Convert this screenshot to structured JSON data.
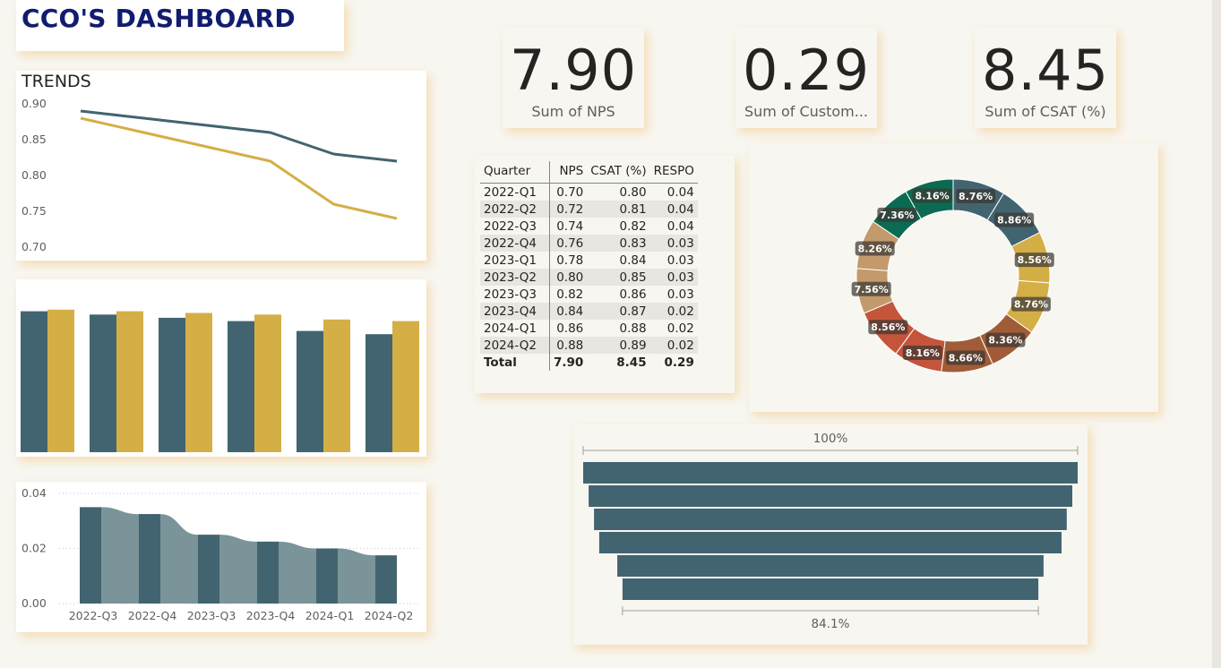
{
  "header": {
    "title": "CCO'S DASHBOARD"
  },
  "kpis": [
    {
      "value": "7.90",
      "label": "Sum of NPS"
    },
    {
      "value": "0.29",
      "label": "Sum of Custom..."
    },
    {
      "value": "8.45",
      "label": "Sum of CSAT (%)"
    }
  ],
  "trends": {
    "title": "TRENDS",
    "y_ticks": [
      "0.90",
      "0.85",
      "0.80",
      "0.75",
      "0.70"
    ]
  },
  "table": {
    "headers": [
      "Quarter",
      "NPS",
      "CSAT (%)",
      "RESPO"
    ],
    "rows": [
      [
        "2022-Q1",
        "0.70",
        "0.80",
        "0.04"
      ],
      [
        "2022-Q2",
        "0.72",
        "0.81",
        "0.04"
      ],
      [
        "2022-Q3",
        "0.74",
        "0.82",
        "0.04"
      ],
      [
        "2022-Q4",
        "0.76",
        "0.83",
        "0.03"
      ],
      [
        "2023-Q1",
        "0.78",
        "0.84",
        "0.03"
      ],
      [
        "2023-Q2",
        "0.80",
        "0.85",
        "0.03"
      ],
      [
        "2023-Q3",
        "0.82",
        "0.86",
        "0.03"
      ],
      [
        "2023-Q4",
        "0.84",
        "0.87",
        "0.02"
      ],
      [
        "2024-Q1",
        "0.86",
        "0.88",
        "0.02"
      ],
      [
        "2024-Q2",
        "0.88",
        "0.89",
        "0.02"
      ]
    ],
    "total": [
      "Total",
      "7.90",
      "8.45",
      "0.29"
    ]
  },
  "colors": {
    "teal": "#426470",
    "gold": "#d4af46",
    "light_teal": "#7a9499",
    "title_navy": "#121c6f"
  },
  "chart_data": [
    {
      "type": "line",
      "title": "TRENDS",
      "ylim": [
        0.7,
        0.9
      ],
      "y_ticks": [
        0.7,
        0.75,
        0.8,
        0.85,
        0.9
      ],
      "grid": false,
      "series": [
        {
          "values": [
            0.89,
            0.88,
            0.87,
            0.86,
            0.83,
            0.82
          ],
          "color": "#426470"
        },
        {
          "values": [
            0.88,
            0.86,
            0.84,
            0.82,
            0.76,
            0.74
          ],
          "color": "#d4af46"
        }
      ]
    },
    {
      "type": "bar",
      "ylim": [
        0,
        1
      ],
      "series": [
        {
          "values": [
            0.86,
            0.84,
            0.82,
            0.8,
            0.74,
            0.72
          ],
          "color": "#426470"
        },
        {
          "values": [
            0.87,
            0.86,
            0.85,
            0.84,
            0.81,
            0.8
          ],
          "color": "#d4af46"
        }
      ]
    },
    {
      "type": "area",
      "ylim": [
        0,
        0.04
      ],
      "y_ticks": [
        "0.04",
        "0.02",
        "0.00"
      ],
      "x_ticks": [
        "2022-Q3",
        "2022-Q4",
        "2023-Q3",
        "2023-Q4",
        "2024-Q1",
        "2024-Q2"
      ],
      "values": [
        0.035,
        0.0325,
        0.025,
        0.0225,
        0.02,
        0.0175
      ],
      "colors": [
        "#426470",
        "#7a9499"
      ]
    },
    {
      "type": "pie",
      "slices": [
        {
          "label": "8.76%",
          "value": 8.76,
          "color": "#426470"
        },
        {
          "label": "8.86%",
          "value": 8.86,
          "color": "#426470"
        },
        {
          "label": "8.56%",
          "value": 8.56,
          "color": "#d4af46"
        },
        {
          "label": "8.76%",
          "value": 8.76,
          "color": "#d4af46"
        },
        {
          "label": "8.36%",
          "value": 8.36,
          "color": "#a15c37"
        },
        {
          "label": "8.66%",
          "value": 8.66,
          "color": "#a15c37"
        },
        {
          "label": "8.16%",
          "value": 8.16,
          "color": "#c4553b"
        },
        {
          "label": "8.56%",
          "value": 8.56,
          "color": "#c4553b"
        },
        {
          "label": "7.56%",
          "value": 7.56,
          "color": "#c39a6b"
        },
        {
          "label": "8.26%",
          "value": 8.26,
          "color": "#c39a6b"
        },
        {
          "label": "7.36%",
          "value": 7.36,
          "color": "#0b6b52"
        },
        {
          "label": "8.16%",
          "value": 8.16,
          "color": "#0b6b52"
        }
      ]
    },
    {
      "type": "bar",
      "orientation": "horizontal-funnel",
      "top_label": "100%",
      "bottom_label": "84.1%",
      "values": [
        1.0,
        0.978,
        0.956,
        0.935,
        0.862,
        0.841
      ],
      "color": "#426470"
    }
  ]
}
